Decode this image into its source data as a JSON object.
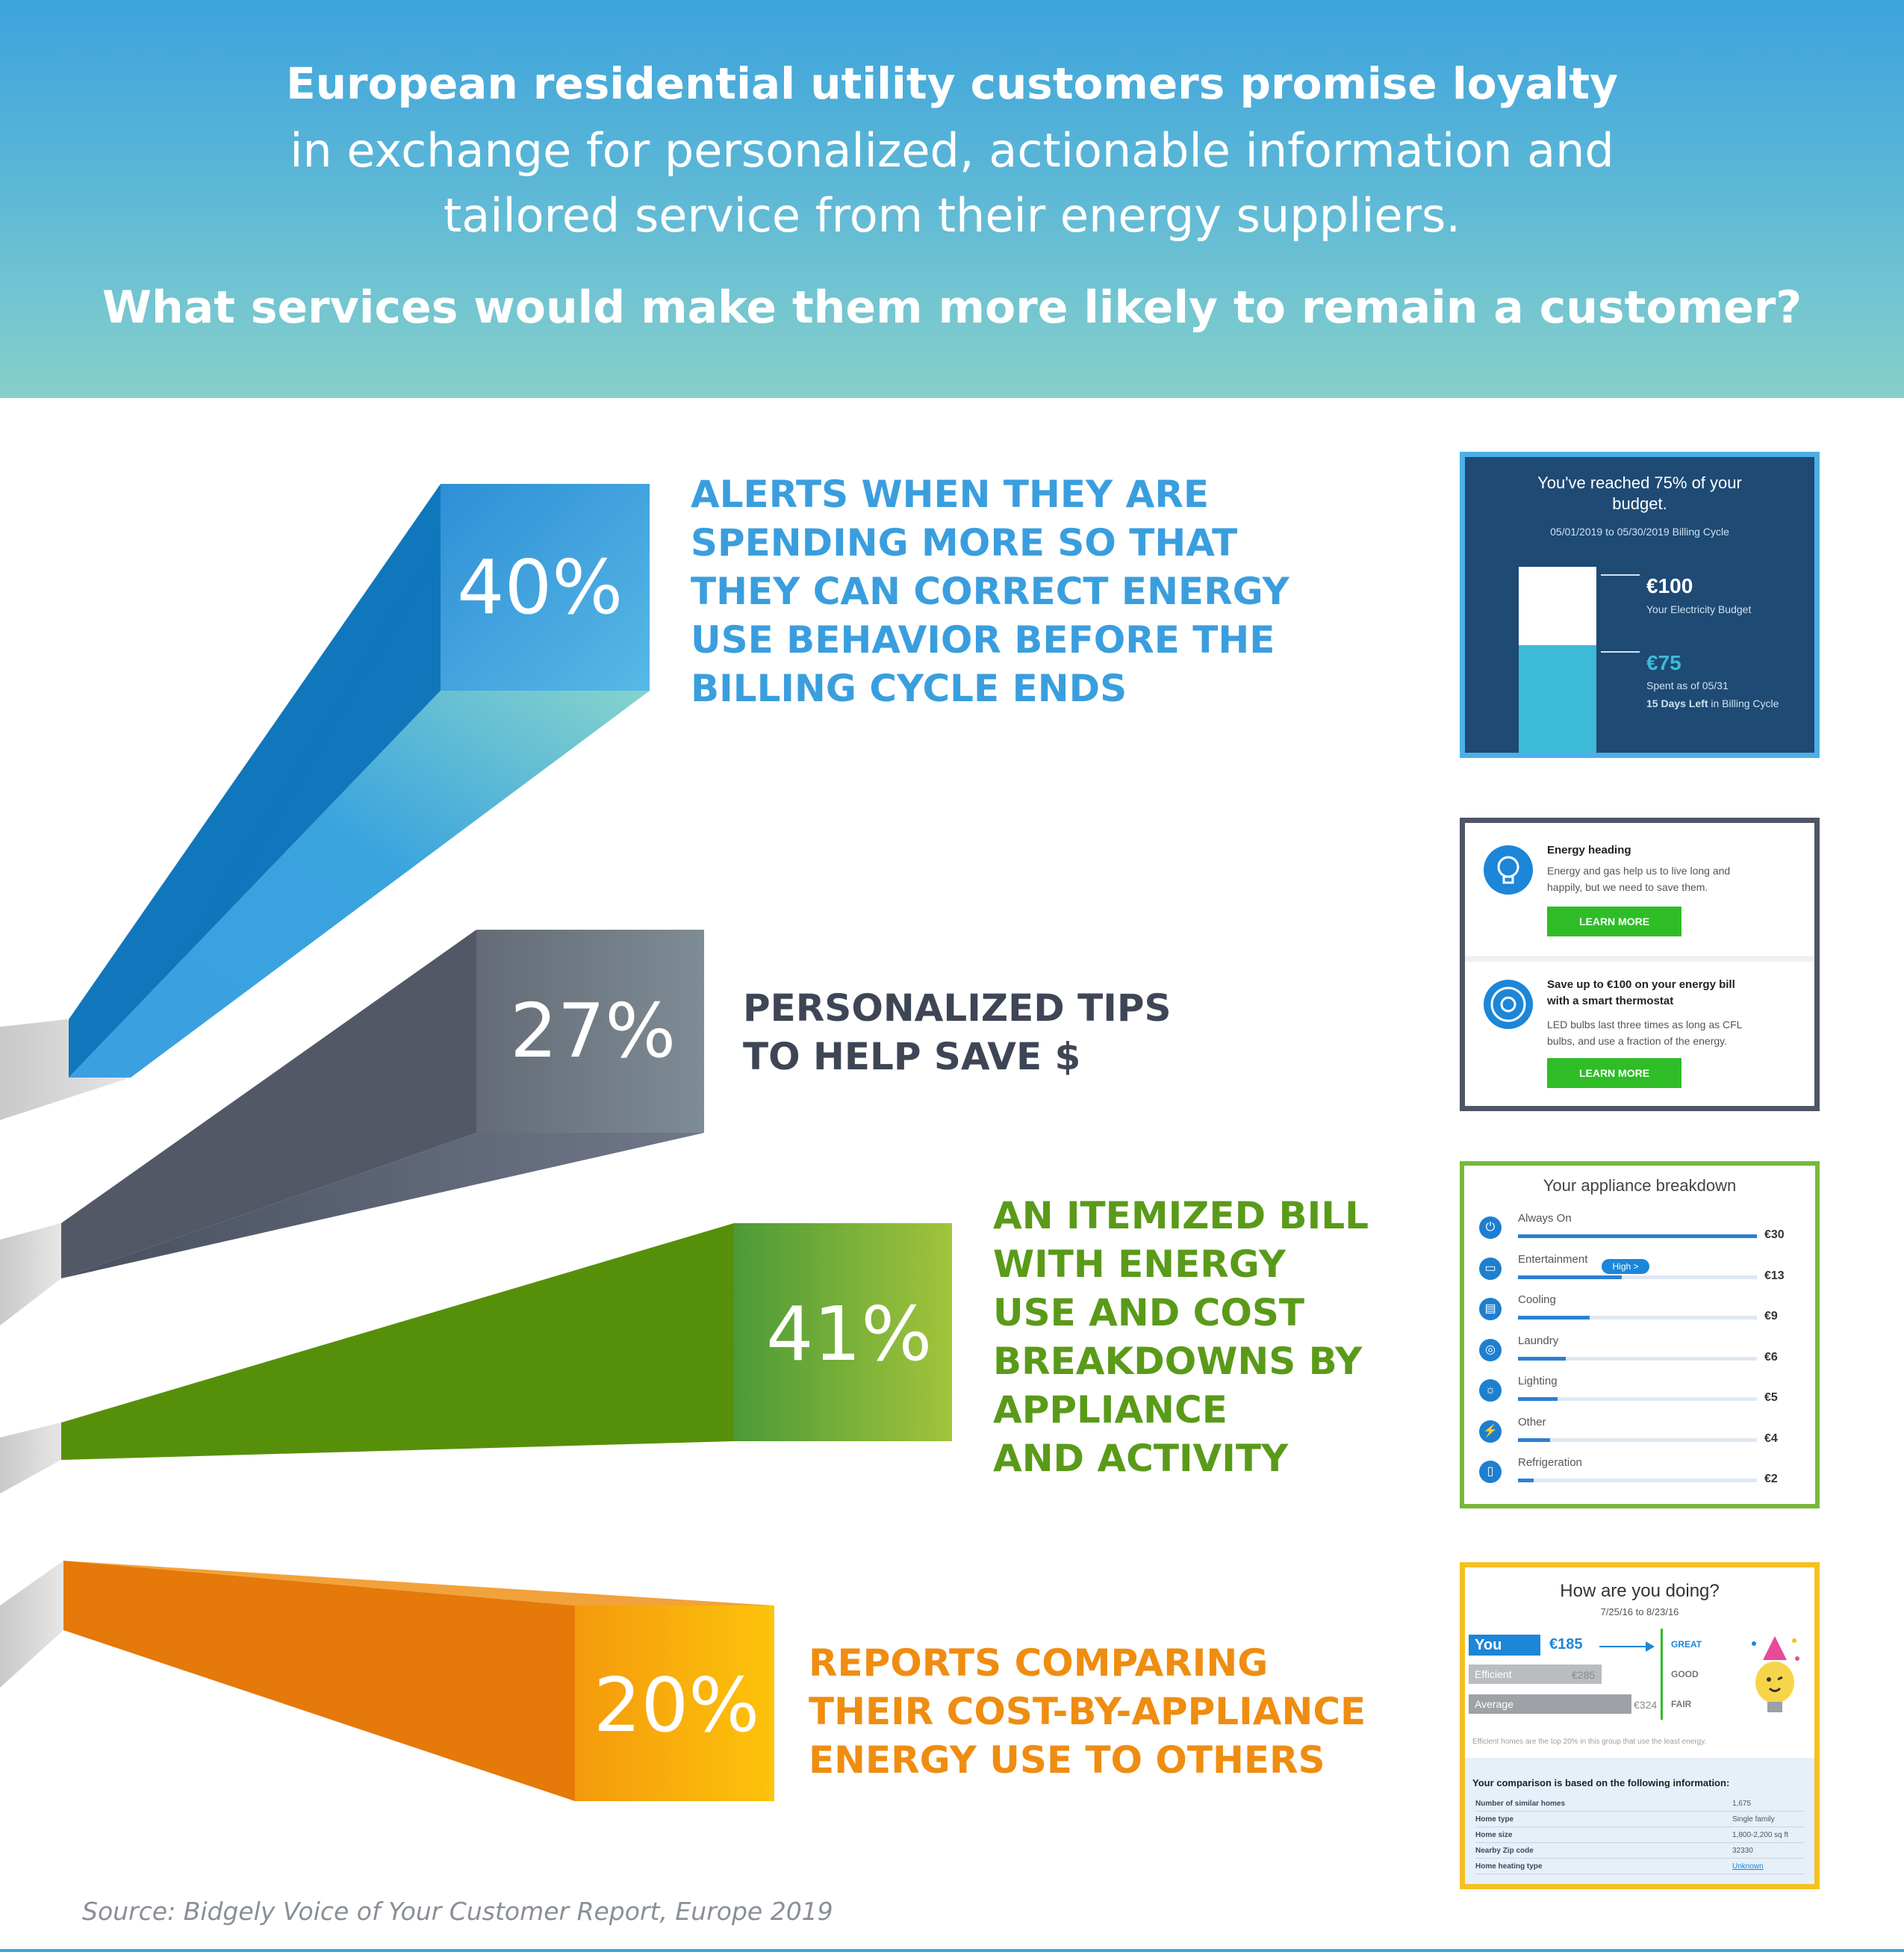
{
  "header": {
    "line1": "European residential utility customers promise loyalty",
    "line2": "in exchange for personalized, actionable information and",
    "line3": "tailored service from their energy suppliers.",
    "question": "What services would make them more likely to remain a customer?"
  },
  "items": [
    {
      "percent": "40%",
      "value": 40,
      "color": "#3a9ede",
      "label_lines": [
        "ALERTS WHEN THEY ARE",
        "SPENDING MORE SO THAT",
        "THEY CAN CORRECT ENERGY",
        "USE BEHAVIOR BEFORE THE",
        "BILLING CYCLE ENDS"
      ]
    },
    {
      "percent": "27%",
      "value": 27,
      "color": "#3e4656",
      "label_lines": [
        "PERSONALIZED TIPS",
        "TO HELP SAVE $"
      ]
    },
    {
      "percent": "41%",
      "value": 41,
      "color": "#5a9a19",
      "label_lines": [
        "AN ITEMIZED BILL",
        "WITH ENERGY",
        "USE AND COST",
        "BREAKDOWNS BY",
        "APPLIANCE",
        "AND ACTIVITY"
      ]
    },
    {
      "percent": "20%",
      "value": 20,
      "color": "#ef8d11",
      "label_lines": [
        "REPORTS COMPARING",
        "THEIR COST-BY-APPLIANCE",
        "ENERGY USE TO OTHERS"
      ]
    }
  ],
  "card_budget": {
    "title_line1": "You've reached 75% of your",
    "title_line2": "budget.",
    "cycle": "05/01/2019 to 05/30/2019 Billing Cycle",
    "budget_amount": "€100",
    "budget_label": "Your Electricity Budget",
    "spent_amount": "€75",
    "spent_label": "Spent as of 05/31",
    "days_left_bold": "15 Days Left",
    "days_left_rest": "in Billing Cycle",
    "fraction_spent": 0.75
  },
  "card_tips": {
    "tip1_title": "Energy heading",
    "tip1_body_line1": "Energy and gas help us to live long and",
    "tip1_body_line2": "happily, but we need to save them.",
    "tip1_button": "LEARN MORE",
    "tip2_title_line1": "Save up to €100 on your energy bill",
    "tip2_title_line2": "with a smart thermostat",
    "tip2_body_line1": "LED bulbs last three times as long as CFL",
    "tip2_body_line2": "bulbs, and use a fraction of the energy.",
    "tip2_button": "LEARN MORE"
  },
  "card_breakdown": {
    "title": "Your appliance breakdown",
    "badge": "High >",
    "rows": [
      {
        "name": "Always On",
        "cost": "€30",
        "value": 30
      },
      {
        "name": "Entertainment",
        "cost": "€13",
        "value": 13
      },
      {
        "name": "Cooling",
        "cost": "€9",
        "value": 9
      },
      {
        "name": "Laundry",
        "cost": "€6",
        "value": 6
      },
      {
        "name": "Lighting",
        "cost": "€5",
        "value": 5
      },
      {
        "name": "Other",
        "cost": "€4",
        "value": 4
      },
      {
        "name": "Refrigeration",
        "cost": "€2",
        "value": 2
      }
    ]
  },
  "card_compare": {
    "title": "How are you doing?",
    "dates": "7/25/16 to 8/23/16",
    "you_label": "You",
    "you_cost": "€185",
    "efficient_label": "Efficient",
    "efficient_cost": "€285",
    "average_label": "Average",
    "average_cost": "€324",
    "scale": [
      "GREAT",
      "GOOD",
      "FAIR"
    ],
    "footnote": "Efficient homes are the top 20% in this group that use the least energy.",
    "info_title": "Your comparison is based on the following information:",
    "info_rows": [
      {
        "label": "Number of similar homes",
        "value": "1,675"
      },
      {
        "label": "Home type",
        "value": "Single family"
      },
      {
        "label": "Home size",
        "value": "1,800-2,200 sq ft"
      },
      {
        "label": "Nearby Zip code",
        "value": "32330"
      },
      {
        "label": "Home heating type",
        "value": "Unknown"
      }
    ]
  },
  "source": "Source: Bidgely Voice of Your Customer Report, Europe 2019"
}
